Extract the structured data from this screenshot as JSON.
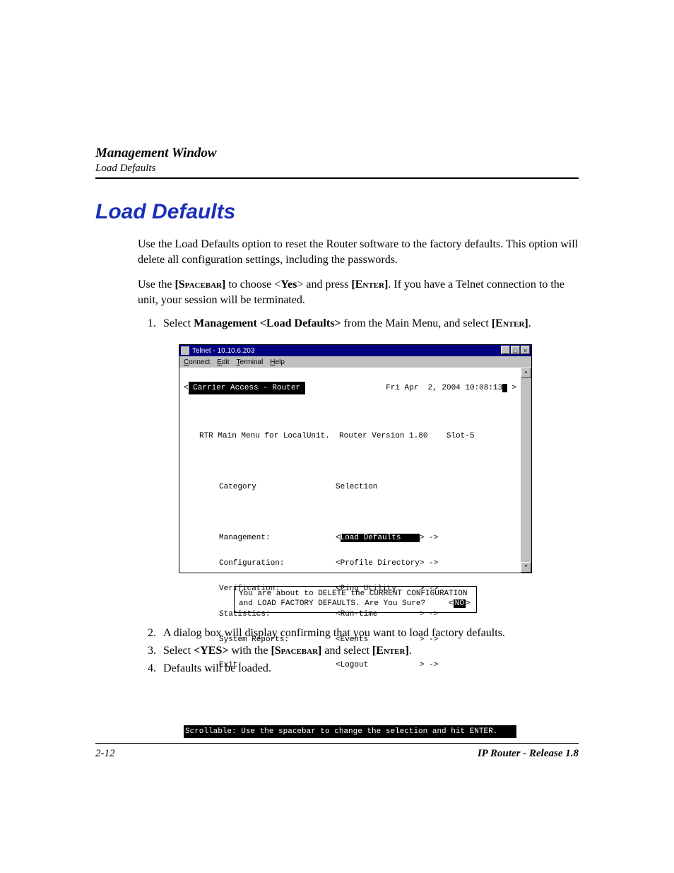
{
  "header": {
    "chapter": "Management Window",
    "sub": "Load Defaults"
  },
  "section_title": "Load Defaults",
  "p1": "Use the Load Defaults option to reset the Router software to the factory defaults. This option will delete all configuration settings, including the passwords.",
  "p2_a": "Use the ",
  "p2_spacebar": "[Spacebar]",
  "p2_b": " to choose <",
  "p2_yes": "Yes",
  "p2_c": "> and press ",
  "p2_enter": "[Enter]",
  "p2_d": ". If you have a Telnet connection to the unit, your session will be terminated.",
  "steps": {
    "s1_a": "Select ",
    "s1_bold1": "Management <Load Defaults>",
    "s1_b": " from the Main Menu, and select ",
    "s1_enter": "[Enter]",
    "s1_c": ".",
    "s2": "A dialog box will display confirming that you want to load factory defaults.",
    "s3_a": "Select ",
    "s3_yes": "<YES>",
    "s3_b": " with the ",
    "s3_spacebar": "[Spacebar]",
    "s3_c": " and select ",
    "s3_enter": "[Enter]",
    "s3_d": ".",
    "s4": "Defaults will be loaded."
  },
  "telnet": {
    "title": "Telnet - 10.10.6.203",
    "menus": {
      "connect": "Connect",
      "edit": "Edit",
      "terminal": "Terminal",
      "help": "Help"
    },
    "top_left_bracket": "<",
    "banner": " Carrier Access - Router ",
    "datetime": "Fri Apr  2, 2004 10:08:13",
    "top_right_bracket": " >",
    "header_line": "RTR Main Menu for LocalUnit.  Router Version 1.80    Slot-5",
    "col_a_hdr": "Category",
    "col_b_hdr": "Selection",
    "rows": [
      {
        "cat": "Management:",
        "sel_pre": "<",
        "sel_mid": "Load Defaults    ",
        "sel_post": "> ->",
        "highlight": true
      },
      {
        "cat": "Configuration:",
        "sel_pre": "<Profile Directory> ->",
        "highlight": false
      },
      {
        "cat": "Verification:",
        "sel_pre": "<Ping Utility     > ->",
        "highlight": false
      },
      {
        "cat": "Statistics:",
        "sel_pre": "<Run-time         > ->",
        "highlight": false
      },
      {
        "cat": "System Reports:",
        "sel_pre": "<Events           > ->",
        "highlight": false
      },
      {
        "cat": "Exit:",
        "sel_pre": "<Logout           > ->",
        "highlight": false
      }
    ],
    "footer": "Scrollable: Use the spacebar to change the selection and hit ENTER."
  },
  "dialog": {
    "line1": "You are about to DELETE the CURRENT CONFIGURATION",
    "line2a": "and LOAD FACTORY DEFAULTS. Are You Sure?",
    "no_label": "NO"
  },
  "footer": {
    "page": "2-12",
    "product": "IP Router - Release 1.8"
  }
}
